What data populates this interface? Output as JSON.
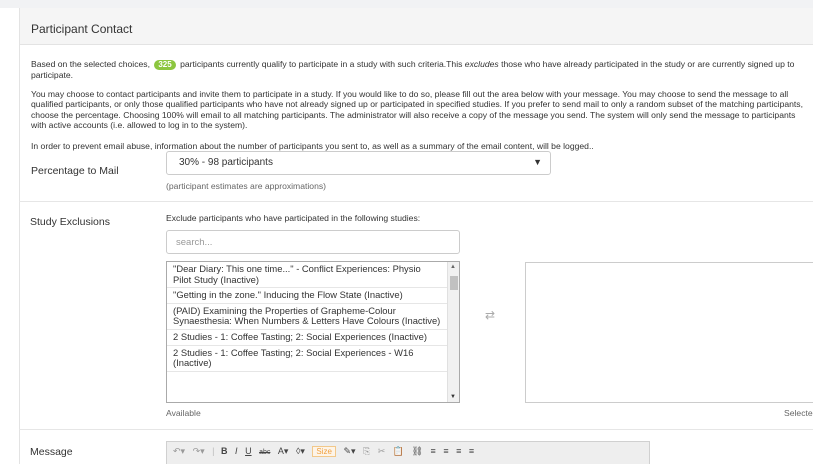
{
  "panel": {
    "title": "Participant Contact"
  },
  "intro": {
    "text_before": "Based on the selected choices,",
    "count": "325",
    "text_mid": "participants currently qualify to participate in a study with such criteria.This",
    "emphasis": "excludes",
    "text_after": "those who have already participated in the study or are currently signed up to participate."
  },
  "description": "You may choose to contact participants and invite them to participate in a study. If you would like to do so, please fill out the area below with your message. You may choose to send the message to all qualified participants, or only those qualified participants who have not already signed up or participated in specified studies. If you prefer to send mail to only a random subset of the matching participants, choose the percentage. Choosing 100% will email to all matching participants. The administrator will also receive a copy of the message you send. The system will only send the message to participants with active accounts (i.e. allowed to log in to the system).",
  "abuse_notice": "In order to prevent email abuse, information about the number of participants you sent to, as well as a summary of the email content, will be logged..",
  "percentage": {
    "label": "Percentage to Mail",
    "selected": "30% - 98 participants",
    "hint": "(participant estimates are approximations)"
  },
  "exclusions": {
    "label": "Study Exclusions",
    "title": "Exclude participants who have participated in the following studies:",
    "search_placeholder": "search...",
    "items": [
      "\"Dear Diary: This one time...\" - Conflict Experiences: Physio Pilot Study (Inactive)",
      "\"Getting in the zone.\" Inducing the Flow State (Inactive)",
      "(PAID) Examining the Properties of Grapheme-Colour Synaesthesia: When Numbers & Letters Have Colours (Inactive)",
      "2 Studies - 1: Coffee Tasting; 2: Social Experiences (Inactive)",
      "2 Studies - 1: Coffee Tasting; 2: Social Experiences - W16 (Inactive)"
    ],
    "available_label": "Available",
    "selected_label": "Selecte"
  },
  "message": {
    "label": "Message",
    "toolbar": {
      "undo": "↶▾",
      "redo": "↷▾",
      "bold": "B",
      "italic": "I",
      "underline": "U",
      "strike": "abc",
      "font_color": "A▾",
      "highlight": "◊▾",
      "size": "Size",
      "format_paint": "✎▾",
      "copy": "⎘",
      "cut": "✂",
      "paste": "📋",
      "link": "⛓",
      "align_left": "≡",
      "align_center": "≡",
      "align_right": "≡",
      "justify": "≡"
    }
  }
}
